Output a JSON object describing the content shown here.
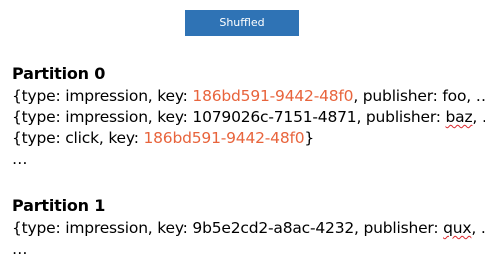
{
  "badge": {
    "label": "Shuffled",
    "color": "#2f73b5"
  },
  "highlight_color": "#e8643c",
  "partitions": [
    {
      "title": "Partition 0",
      "records": [
        {
          "before": "{type: impression, key: ",
          "key": "186bd591-9442-48f0",
          "key_highlighted": true,
          "after_pre": ", publisher: ",
          "publisher": "foo",
          "publisher_flagged": false,
          "after": ", …}"
        },
        {
          "before": "{type: impression, key: ",
          "key": "1079026c-7151-4871",
          "key_highlighted": false,
          "after_pre": ", publisher: ",
          "publisher": "baz",
          "publisher_flagged": true,
          "after": ", …}"
        },
        {
          "before": "{type: click, key: ",
          "key": "186bd591-9442-48f0",
          "key_highlighted": true,
          "tail": "}"
        }
      ],
      "ellipsis": "…"
    },
    {
      "title": "Partition 1",
      "records": [
        {
          "before": "{type: impression, key: ",
          "key": "9b5e2cd2-a8ac-4232",
          "key_highlighted": false,
          "after_pre": ", publisher: ",
          "publisher": "qux",
          "publisher_flagged": true,
          "after": ", …}"
        }
      ],
      "ellipsis": "…"
    }
  ]
}
